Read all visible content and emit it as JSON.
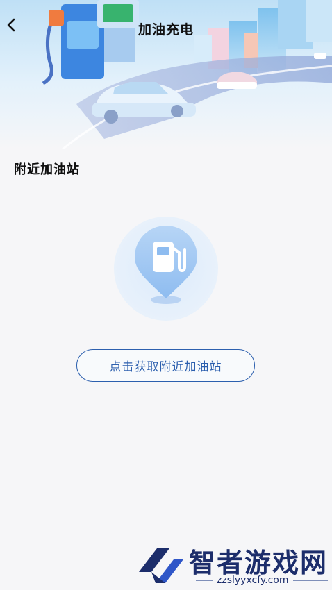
{
  "header": {
    "title": "加油充电"
  },
  "section": {
    "title": "附近加油站"
  },
  "action": {
    "locate_label": "点击获取附近加油站"
  },
  "watermark": {
    "title": "智者游戏网",
    "url": "zzslyyxcfy.com"
  },
  "icons": {
    "back": "chevron-left-icon",
    "empty_state": "fuel-pump-pin-icon"
  },
  "colors": {
    "primary": "#2c5fae",
    "background": "#f6f6f8",
    "hero_sky": "#cfe6f7",
    "watermark": "#1c2d6b"
  }
}
